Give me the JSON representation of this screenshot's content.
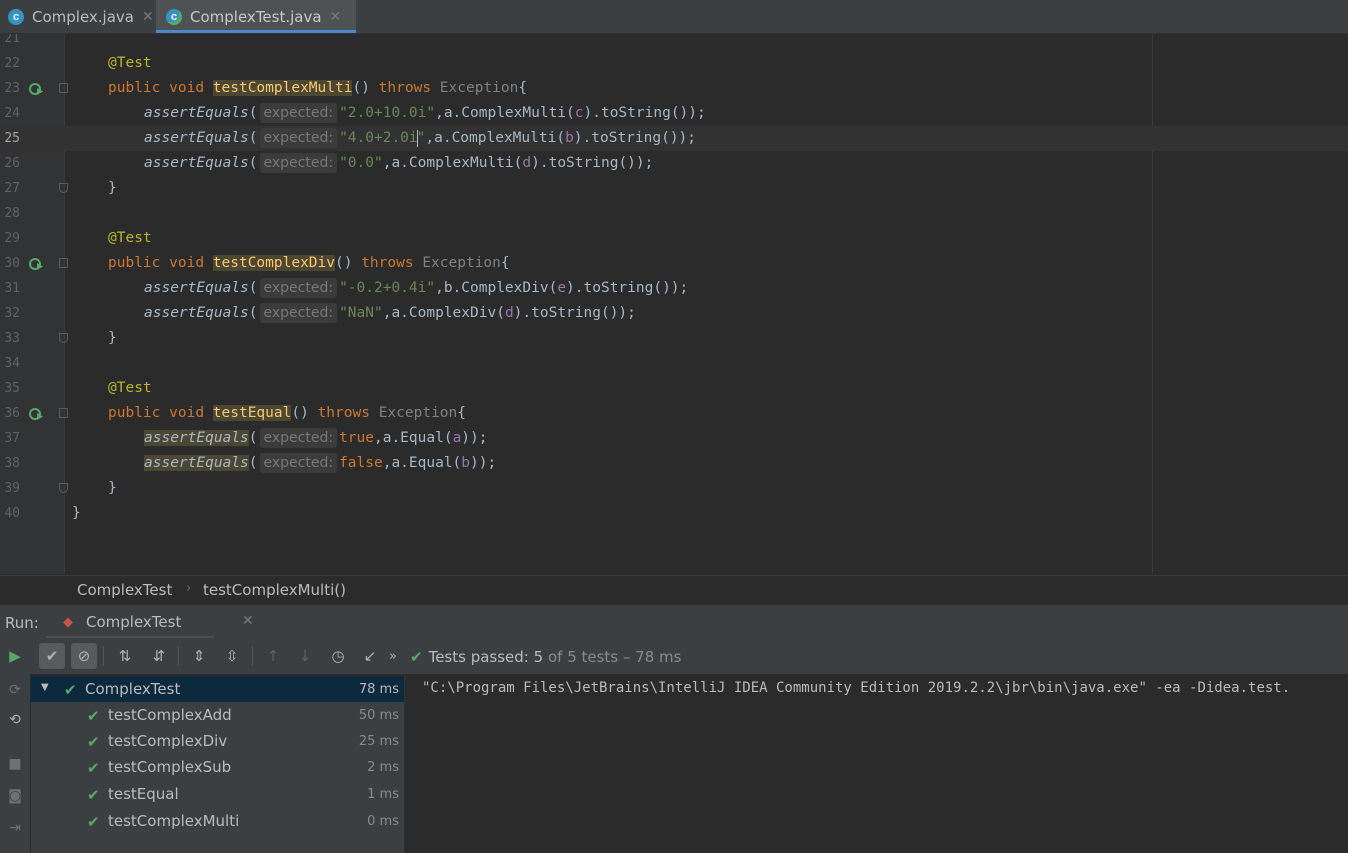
{
  "tabs": [
    {
      "label": "Complex.java",
      "icon": "java-class-icon",
      "active": false
    },
    {
      "label": "ComplexTest.java",
      "icon": "java-test-class-icon",
      "active": true
    }
  ],
  "editor": {
    "current_line": 25,
    "hint_label": "expected:",
    "lines": [
      {
        "num": "21"
      },
      {
        "num": "22"
      },
      {
        "num": "23"
      },
      {
        "num": "24"
      },
      {
        "num": "25"
      },
      {
        "num": "26"
      },
      {
        "num": "27"
      },
      {
        "num": "28"
      },
      {
        "num": "29"
      },
      {
        "num": "30"
      },
      {
        "num": "31"
      },
      {
        "num": "32"
      },
      {
        "num": "33"
      },
      {
        "num": "34"
      },
      {
        "num": "35"
      },
      {
        "num": "36"
      },
      {
        "num": "37"
      },
      {
        "num": "38"
      },
      {
        "num": "39"
      },
      {
        "num": "40"
      }
    ],
    "tokens": {
      "annotation": "@Test",
      "public": "public",
      "void": "void",
      "throws": "throws",
      "exception": "Exception",
      "assert": "assertEquals",
      "m_multi": "testComplexMulti",
      "m_div": "testComplexDiv",
      "m_equal": "testEqual",
      "s24": "\"2.0+10.0i\"",
      "s25a": "\"4.0+2.0i",
      "s25b": "\"",
      "s26": "\"0.0\"",
      "s31": "\"-0.2+0.4i\"",
      "s32": "\"NaN\"",
      "true": "true",
      "false": "false",
      "t24": ",a.ComplexMulti(",
      "a24": "c",
      "e24": ").toString());",
      "t25": ",a.ComplexMulti(",
      "a25": "b",
      "e25": ").toString());",
      "t26": ",a.ComplexMulti(",
      "a26": "d",
      "e26": ").toString());",
      "t31": ",b.ComplexDiv(",
      "a31": "e",
      "e31": ").toString());",
      "t32": ",a.ComplexDiv(",
      "a32": "d",
      "e32": ").toString());",
      "t37": ",a.Equal(",
      "a37": "a",
      "e37": "));",
      "t38": ",a.Equal(",
      "a38": "b",
      "e38": "));",
      "sig_tail": "()",
      "brace_open": "{",
      "brace_close": "}",
      "paren_open": "("
    }
  },
  "breadcrumb": [
    "ComplexTest",
    "testComplexMulti()"
  ],
  "run": {
    "label": "Run:",
    "tab": "ComplexTest",
    "status_prefix": "Tests passed:",
    "status_count": "5",
    "status_suffix": "of 5 tests – 78 ms",
    "tree": [
      {
        "name": "ComplexTest",
        "time": "78 ms",
        "root": true
      },
      {
        "name": "testComplexAdd",
        "time": "50 ms"
      },
      {
        "name": "testComplexDiv",
        "time": "25 ms"
      },
      {
        "name": "testComplexSub",
        "time": "2 ms"
      },
      {
        "name": "testEqual",
        "time": "1 ms"
      },
      {
        "name": "testComplexMulti",
        "time": "0 ms"
      }
    ],
    "console": "\"C:\\Program Files\\JetBrains\\IntelliJ IDEA Community Edition 2019.2.2\\jbr\\bin\\java.exe\" -ea -Didea.test."
  },
  "colors": {
    "keyword": "#cc7832",
    "string": "#6a8759",
    "method": "#ffc66d",
    "annotation": "#bbb529",
    "field": "#9876aa",
    "passed": "#59a869",
    "selection": "#0d293e"
  }
}
